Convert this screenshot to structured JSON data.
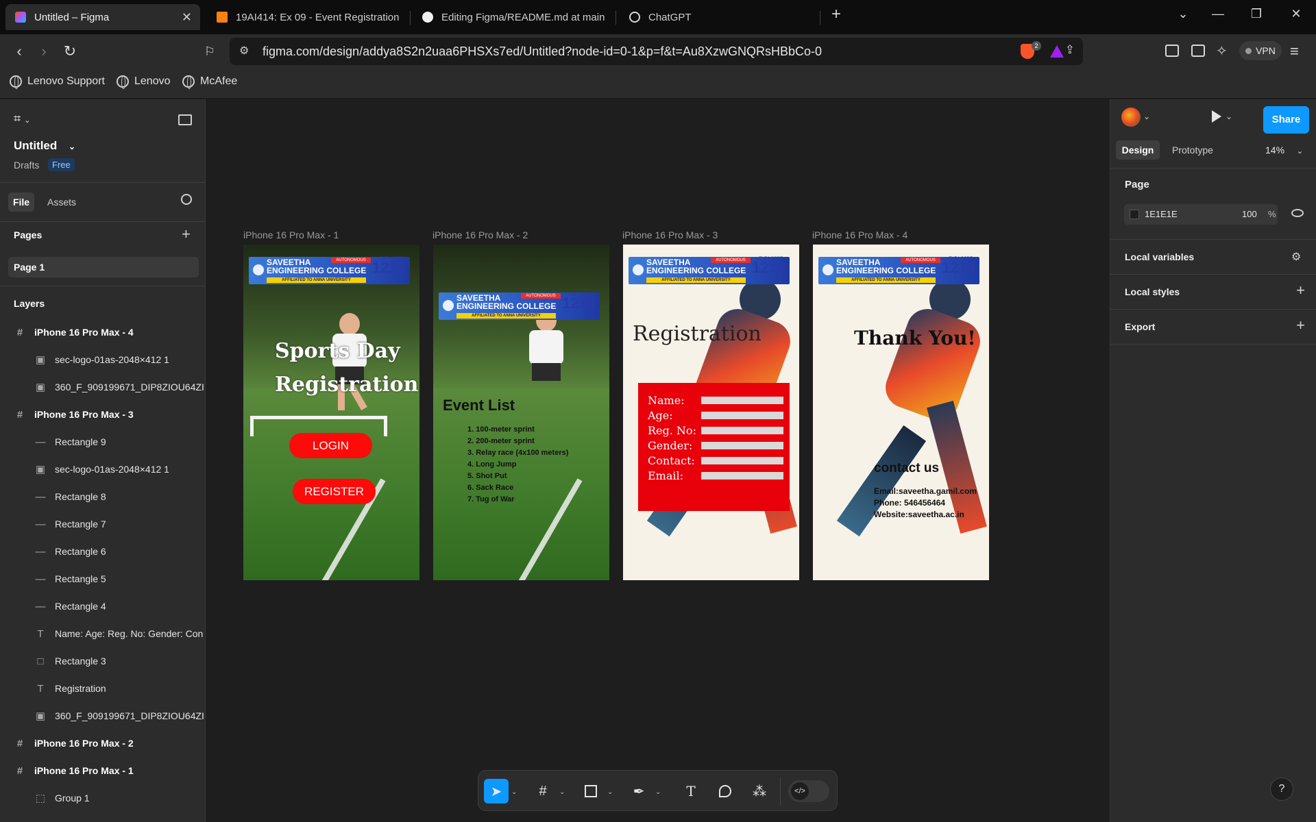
{
  "browser": {
    "tabs": [
      {
        "title": "Untitled – Figma",
        "active": true
      },
      {
        "title": "19AI414: Ex 09 - Event Registration"
      },
      {
        "title": "Editing Figma/README.md at main"
      },
      {
        "title": "ChatGPT"
      }
    ],
    "url": "figma.com/design/addya8S2n2uaa6PHSXs7ed/Untitled?node-id=0-1&p=f&t=Au8XzwGNQRsHBbCo-0",
    "vpn_label": "VPN",
    "shield_badge": "2",
    "bookmarks": [
      "Lenovo Support",
      "Lenovo",
      "McAfee"
    ]
  },
  "left_panel": {
    "file_title": "Untitled",
    "drafts_label": "Drafts",
    "plan_badge": "Free",
    "tabs": [
      "File",
      "Assets"
    ],
    "pages_heading": "Pages",
    "pages": [
      "Page 1"
    ],
    "layers_heading": "Layers",
    "layers": [
      {
        "name": "iPhone 16 Pro Max - 4",
        "type": "frame",
        "icon": "frame-icon"
      },
      {
        "name": "sec-logo-01as-2048×412 1",
        "type": "image",
        "icon": "image-icon"
      },
      {
        "name": "360_F_909199671_DIP8ZIOU64ZI",
        "type": "image",
        "icon": "image-icon"
      },
      {
        "name": "iPhone 16 Pro Max - 3",
        "type": "frame",
        "icon": "frame-icon"
      },
      {
        "name": "Rectangle 9",
        "type": "line",
        "icon": "line-icon"
      },
      {
        "name": "sec-logo-01as-2048×412 1",
        "type": "image",
        "icon": "image-icon"
      },
      {
        "name": "Rectangle 8",
        "type": "line",
        "icon": "line-icon"
      },
      {
        "name": "Rectangle 7",
        "type": "line",
        "icon": "line-icon"
      },
      {
        "name": "Rectangle 6",
        "type": "line",
        "icon": "line-icon"
      },
      {
        "name": "Rectangle 5",
        "type": "line",
        "icon": "line-icon"
      },
      {
        "name": "Rectangle 4",
        "type": "line",
        "icon": "line-icon"
      },
      {
        "name": "Name: Age: Reg. No: Gender: Con",
        "type": "text",
        "icon": "text-icon"
      },
      {
        "name": "Rectangle 3",
        "type": "rect",
        "icon": "rectangle-icon"
      },
      {
        "name": "Registration",
        "type": "text",
        "icon": "text-icon"
      },
      {
        "name": "360_F_909199671_DIP8ZIOU64ZI",
        "type": "image",
        "icon": "image-icon"
      },
      {
        "name": "iPhone 16 Pro Max - 2",
        "type": "frame",
        "icon": "frame-icon"
      },
      {
        "name": "iPhone 16 Pro Max - 1",
        "type": "frame",
        "icon": "frame-icon"
      },
      {
        "name": "Group 1",
        "type": "group",
        "icon": "group-icon"
      }
    ]
  },
  "canvas": {
    "frames": [
      {
        "label": "iPhone 16 Pro Max - 1"
      },
      {
        "label": "iPhone 16 Pro Max - 2"
      },
      {
        "label": "iPhone 16 Pro Max - 3"
      },
      {
        "label": "iPhone 16 Pro Max - 4"
      }
    ],
    "logo": {
      "college": "SAVEETHA",
      "college2": "ENGINEERING COLLEGE",
      "autonomous": "AUTONOMOUS",
      "affiliated": "AFFILIATED TO ANNA UNIVERSITY",
      "tnea_label": "TNEA CODE",
      "tnea_code": "1216"
    },
    "frame1": {
      "title_line1": "Sports Day",
      "title_line2": "Registration",
      "login_label": "LOGIN",
      "register_label": "REGISTER"
    },
    "frame2": {
      "heading": "Event List",
      "events": [
        "1. 100-meter sprint",
        "2. 200-meter sprint",
        "3. Relay race (4x100 meters)",
        "4. Long Jump",
        "5. Shot Put",
        "6. Sack Race",
        "7. Tug of War"
      ]
    },
    "frame3": {
      "heading": "Registration",
      "fields": [
        "Name:",
        "Age:",
        "Reg. No:",
        "Gender:",
        "Contact:",
        "Email:"
      ]
    },
    "frame4": {
      "heading": "Thank You!",
      "contact_heading": "contact us",
      "contact_lines": [
        "Email:saveetha.gamil.com",
        "Phone: 546456464",
        "Website:saveetha.ac.in"
      ]
    }
  },
  "right_panel": {
    "share_label": "Share",
    "tabs": [
      "Design",
      "Prototype"
    ],
    "zoom": "14%",
    "page_heading": "Page",
    "page_color": "1E1E1E",
    "page_opacity": "100",
    "percent_sign": "%",
    "sections": [
      "Local variables",
      "Local styles",
      "Export"
    ]
  },
  "toolbar": {
    "tools": [
      "move-tool",
      "frame-tool",
      "rectangle-tool",
      "pen-tool",
      "text-tool",
      "comment-tool",
      "components-tool",
      "dev-mode-toggle"
    ]
  },
  "help_label": "?",
  "colors": {
    "figma_blue": "#0d99ff",
    "registration_red": "#e8000b",
    "canvas_bg": "#1E1E1E"
  }
}
